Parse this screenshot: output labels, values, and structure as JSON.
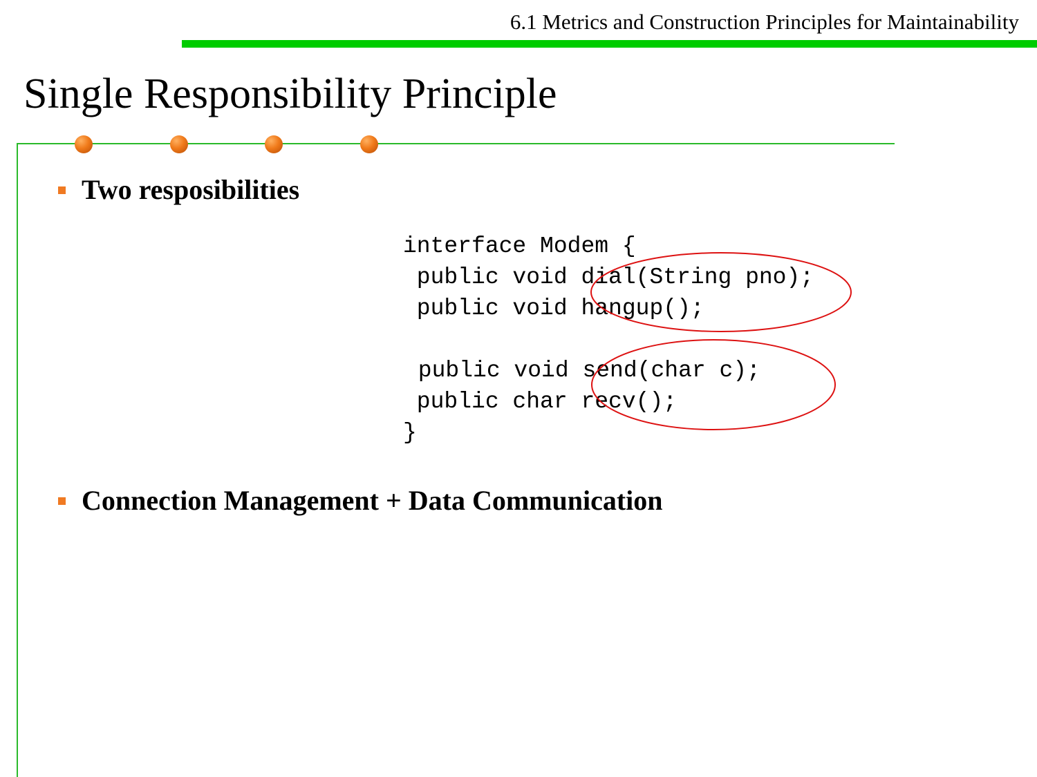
{
  "header": {
    "section_title": "6.1 Metrics and Construction Principles for Maintainability"
  },
  "slide": {
    "title": "Single Responsibility Principle",
    "bullets": [
      {
        "text": "Two resposibilities"
      },
      {
        "text": "Connection Management + Data Communication"
      }
    ],
    "code_lines": [
      "interface Modem {",
      " public void dial(String pno);",
      " public void hangup();",
      " public void send(char c);",
      " public char recv();",
      "}"
    ]
  },
  "colors": {
    "header_bar": "#00cc00",
    "frame_line": "#2aba2a",
    "bullet": "#f07a22",
    "ellipse": "#dd1111"
  }
}
